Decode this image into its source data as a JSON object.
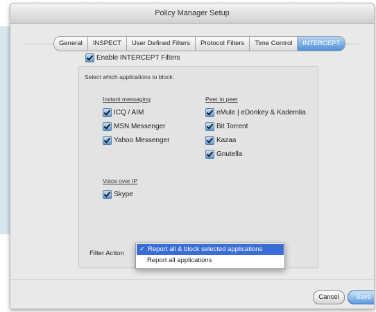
{
  "window": {
    "title": "Policy Manager Setup"
  },
  "tabs": [
    {
      "label": "General",
      "active": false
    },
    {
      "label": "INSPECT",
      "active": false
    },
    {
      "label": "User Defined Filters",
      "active": false
    },
    {
      "label": "Protocol Filters",
      "active": false
    },
    {
      "label": "Time Control",
      "active": false
    },
    {
      "label": "INTERCEPT",
      "active": true
    }
  ],
  "enable": {
    "label": "Enable INTERCEPT Filters",
    "checked": true
  },
  "groupbox": {
    "caption": "Select which applications to block:"
  },
  "sections": {
    "instant_messaging": {
      "label": "Instant messaging",
      "items": [
        {
          "label": "ICQ / AIM",
          "checked": true
        },
        {
          "label": "MSN Messenger",
          "checked": true
        },
        {
          "label": "Yahoo Messenger",
          "checked": true
        }
      ]
    },
    "peer_to_peer": {
      "label": "Peer to peer",
      "items": [
        {
          "label": "eMule | eDonkey & Kademlia",
          "checked": true
        },
        {
          "label": "Bit Torrent",
          "checked": true
        },
        {
          "label": "Kazaa",
          "checked": true
        },
        {
          "label": "Gnutella",
          "checked": true
        }
      ]
    },
    "voice_over_ip": {
      "label": "Voice over IP",
      "items": [
        {
          "label": "Skype",
          "checked": true
        }
      ]
    }
  },
  "filter_action": {
    "label": "Filter Action",
    "options": [
      {
        "label": "Report all & block selected applications",
        "selected": true
      },
      {
        "label": "Report all applications",
        "selected": false
      }
    ],
    "check_glyph": "✓"
  },
  "buttons": {
    "cancel": "Cancel",
    "save": "Save"
  },
  "colors": {
    "accent": "#3a6ed6",
    "active_tab": "#4f8fd6"
  }
}
